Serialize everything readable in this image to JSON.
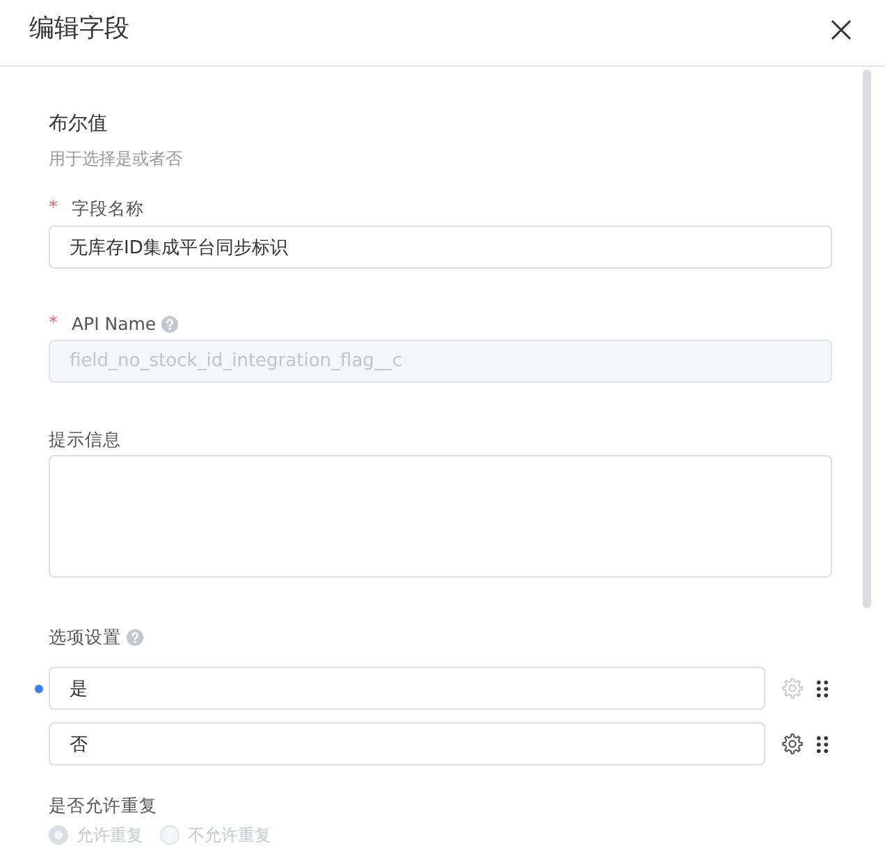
{
  "dialog": {
    "title": "编辑字段"
  },
  "field_type": {
    "name": "布尔值",
    "description": "用于选择是或者否"
  },
  "fields": [
    {
      "kind": "input",
      "label": "字段名称",
      "required_mark": "*",
      "value": "无库存ID集成平台同步标识",
      "disabled": false
    },
    {
      "kind": "input",
      "label": "API Name",
      "required_mark": "*",
      "help": true,
      "value": "field_no_stock_id_integration_flag__c",
      "disabled": true
    },
    {
      "kind": "textarea",
      "label": "提示信息"
    }
  ],
  "options_section": {
    "label": "选项设置",
    "help": true,
    "options": [
      {
        "label": "是",
        "default": true,
        "settings_disabled": true
      },
      {
        "label": "否",
        "default": false,
        "settings_disabled": false
      }
    ]
  },
  "duplicate_setting": {
    "label": "是否允许重复",
    "choices": [
      {
        "label": "允许重复",
        "selected": true,
        "disabled": true
      },
      {
        "label": "不允许重复",
        "selected": false,
        "disabled": true
      }
    ]
  }
}
